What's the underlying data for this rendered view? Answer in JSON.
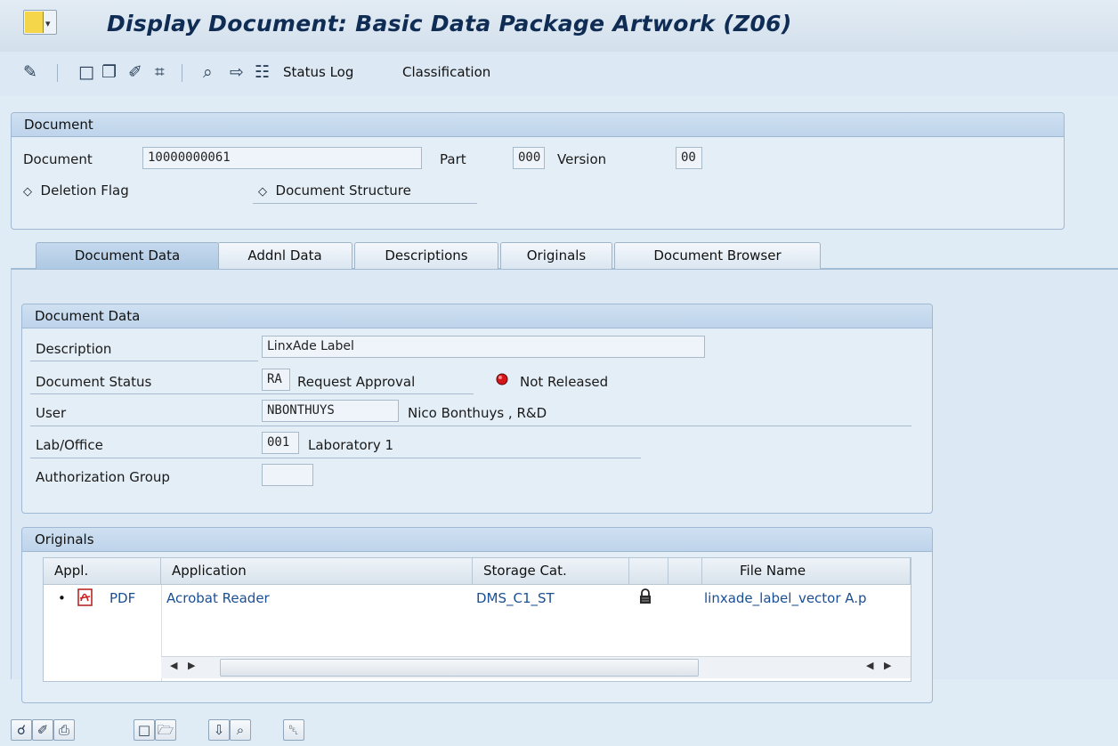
{
  "window": {
    "title": "Display Document: Basic Data Package Artwork (Z06)",
    "title_icon": "sap-menu-icon"
  },
  "toolbar": {
    "icons": [
      "other-object-icon",
      "create-icon",
      "copy-icon",
      "edit-icon",
      "find-icon",
      "display-object-links-icon",
      "navigate-icon",
      "hierarchy-icon"
    ],
    "status_log": "Status Log",
    "classification": "Classification"
  },
  "document_group": {
    "header": "Document",
    "document_label": "Document",
    "document_value": "10000000061",
    "part_label": "Part",
    "part_value": "000",
    "version_label": "Version",
    "version_value": "00",
    "deletion_flag": "Deletion Flag",
    "document_structure": "Document Structure"
  },
  "tabs": [
    {
      "label": "Document Data",
      "active": true
    },
    {
      "label": "Addnl Data",
      "active": false
    },
    {
      "label": "Descriptions",
      "active": false
    },
    {
      "label": "Originals",
      "active": false
    },
    {
      "label": "Document Browser",
      "active": false
    }
  ],
  "document_data": {
    "header": "Document Data",
    "description_label": "Description",
    "description_value": "LinxAde Label",
    "status_label": "Document Status",
    "status_code": "RA",
    "status_text": "Request Approval",
    "release_status": "Not Released",
    "user_label": "User",
    "user_value": "NBONTHUYS",
    "user_name": "Nico Bonthuys , R&D",
    "lab_label": "Lab/Office",
    "lab_code": "001",
    "lab_text": "Laboratory 1",
    "auth_label": "Authorization Group",
    "auth_value": ""
  },
  "originals": {
    "header": "Originals",
    "columns": [
      "Appl.",
      "Application",
      "Storage Cat.",
      "",
      "",
      "File Name"
    ],
    "rows": [
      {
        "appl": "PDF",
        "application": "Acrobat Reader",
        "storage": "DMS_C1_ST",
        "locked": true,
        "file_name": "linxade_label_vector A.p"
      }
    ]
  },
  "colors": {
    "title": "#0f2c55",
    "link": "#1b4f93",
    "status_red": "#d4161a"
  }
}
